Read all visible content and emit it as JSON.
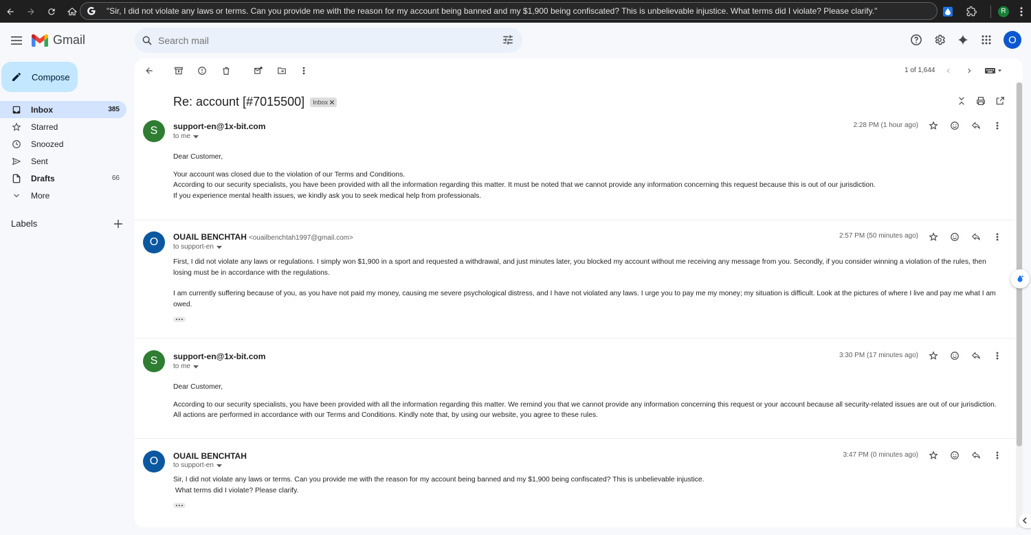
{
  "browser": {
    "url_text": "\"Sir, I did not violate any laws or terms. Can you provide me with the reason for my account being banned and my $1,900 being confiscated? This is unbelievable injustice. What terms did I violate? Please clarify.\"",
    "profile_initial": "R"
  },
  "header": {
    "app_name": "Gmail",
    "search_placeholder": "Search mail",
    "account_initial": "O"
  },
  "sidebar": {
    "compose_label": "Compose",
    "items": [
      {
        "label": "Inbox",
        "count": "385",
        "icon": "inbox-icon",
        "active": true
      },
      {
        "label": "Starred",
        "count": "",
        "icon": "star-icon"
      },
      {
        "label": "Snoozed",
        "count": "",
        "icon": "clock-icon"
      },
      {
        "label": "Sent",
        "count": "",
        "icon": "send-icon"
      },
      {
        "label": "Drafts",
        "count": "66",
        "icon": "draft-icon"
      },
      {
        "label": "More",
        "count": "",
        "icon": "chevron-down-icon"
      }
    ],
    "labels_heading": "Labels"
  },
  "toolbar": {
    "pager": "1 of 1,644"
  },
  "thread": {
    "subject": "Re: account [#7015500]",
    "label_chip": "Inbox",
    "messages": [
      {
        "avatar": "S",
        "avatar_color": "#2e7d32",
        "sender": "support-en@1x-bit.com",
        "email": "",
        "to": "to me",
        "time": "2:28 PM (1 hour ago)",
        "paragraphs": [
          "Dear Customer,",
          "Your account was closed due to the violation of our Terms and Conditions.",
          "According to our security specialists, you have been provided with all the information regarding this matter. It must be noted that we cannot provide any information concerning this request because this is out of our jurisdiction.",
          "If you experience mental health issues, we kindly ask you to seek medical help from professionals."
        ]
      },
      {
        "avatar": "O",
        "avatar_color": "#0b57a0",
        "sender": "OUAIL BENCHTAH",
        "email": "<ouailbenchtah1997@gmail.com>",
        "to": "to support-en",
        "time": "2:57 PM (50 minutes ago)",
        "paragraphs": [
          "First, I did not violate any laws or regulations. I simply won $1,900 in a sport and requested a withdrawal, and just minutes later, you blocked my account without me receiving any message from you. Secondly, if you consider winning a violation of the rules, then losing must be in accordance with the regulations.",
          "I am currently suffering because of you, as you have not paid my money, causing me severe psychological distress, and I have not violated any laws. I urge you to pay me my money; my situation is difficult. Look at the pictures of where I live and pay me what I am owed."
        ]
      },
      {
        "avatar": "S",
        "avatar_color": "#2e7d32",
        "sender": "support-en@1x-bit.com",
        "email": "",
        "to": "to me",
        "time": "3:30 PM (17 minutes ago)",
        "paragraphs": [
          "Dear Customer,",
          "According to our security specialists, you have been provided with all the information regarding this matter. We remind you that we cannot provide any information concerning this request or your account because all security-related issues are out of our jurisdiction.",
          "All actions are performed in accordance with our Terms and Conditions. Kindly note that, by using our website, you agree to these rules."
        ]
      },
      {
        "avatar": "O",
        "avatar_color": "#0b57a0",
        "sender": "OUAIL BENCHTAH",
        "email": "",
        "to": "to support-en",
        "time": "3:47 PM (0 minutes ago)",
        "paragraphs": [
          "Sir, I did not violate any laws or terms. Can you provide me with the reason for my account being banned and my $1,900 being confiscated? This is unbelievable injustice.",
          " What terms did I violate? Please clarify."
        ]
      }
    ]
  }
}
